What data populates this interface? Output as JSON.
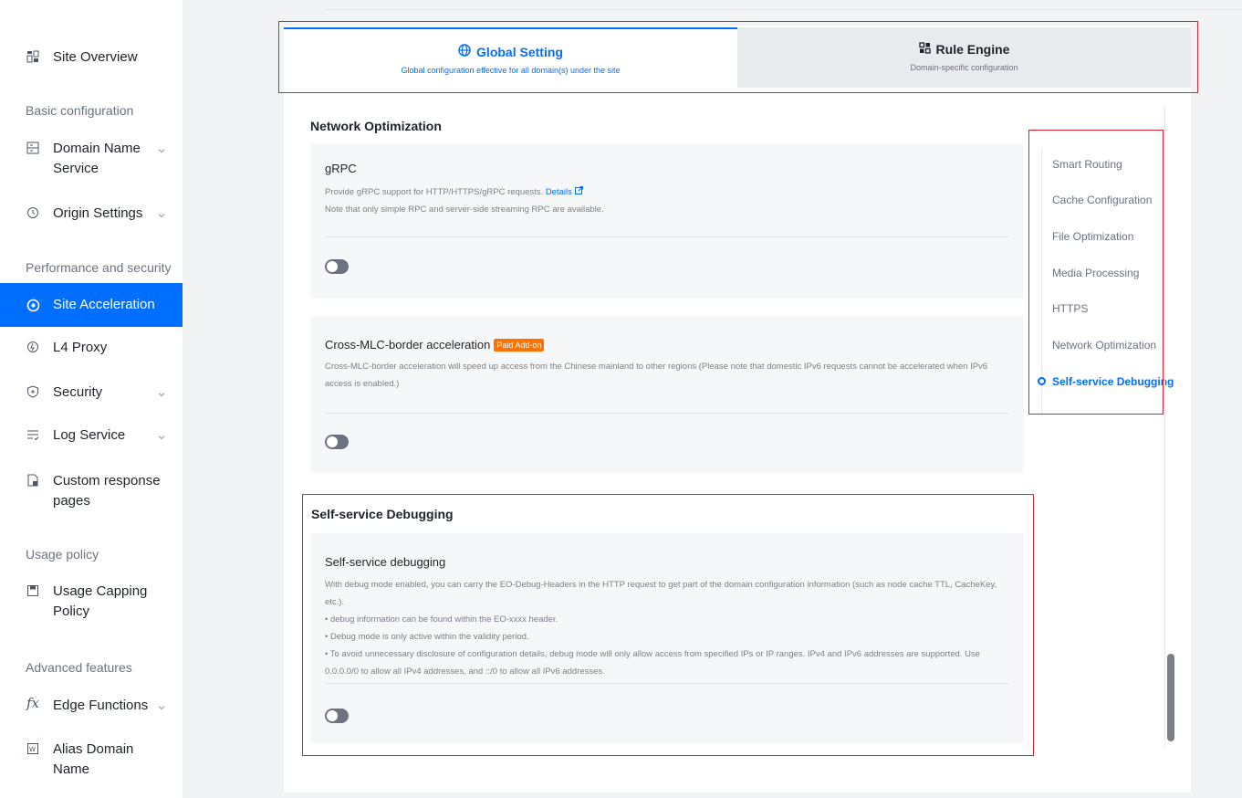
{
  "sidebar": {
    "site_overview": "Site Overview",
    "group_basic": "Basic configuration",
    "domain_name_service": "Domain Name Service",
    "origin_settings": "Origin Settings",
    "group_performance": "Performance and security",
    "site_acceleration": "Site Acceleration",
    "l4_proxy": "L4 Proxy",
    "security": "Security",
    "log_service": "Log Service",
    "custom_response_pages": "Custom response pages",
    "group_usage": "Usage policy",
    "usage_capping_policy": "Usage Capping Policy",
    "group_advanced": "Advanced features",
    "edge_functions": "Edge Functions",
    "alias_domain_name": "Alias Domain Name"
  },
  "tabs": {
    "global": {
      "title": "Global Setting",
      "subtitle": "Global configuration effective for all domain(s) under the site"
    },
    "rule": {
      "title": "Rule Engine",
      "subtitle": "Domain-specific configuration"
    }
  },
  "sections": {
    "network_optimization": "Network Optimization",
    "self_service_debugging": "Self-service Debugging"
  },
  "cards": {
    "grpc": {
      "title": "gRPC",
      "desc_line1": "Provide gRPC support for HTTP/HTTPS/gRPC requests.",
      "details_link": "Details",
      "desc_line2": "Note that only simple RPC and server-side streaming RPC are available."
    },
    "cross_mlc": {
      "title": "Cross-MLC-border acceleration",
      "badge": "Paid Add-on",
      "desc": "Cross-MLC-border acceleration will speed up access from the Chinese mainland to other regions (Please note that domestic IPv6 requests cannot be accelerated when IPv6 access is enabled.)"
    },
    "debug": {
      "title": "Self-service debugging",
      "desc_line1": "With debug mode enabled, you can carry the EO-Debug-Headers in the HTTP request to get part of the domain configuration information (such as node cache TTL, CacheKey, etc.).",
      "bullet1": "• debug information can be found within the EO-xxxx header.",
      "bullet2": "• Debug mode is only active within the validity period.",
      "bullet3": "• To avoid unnecessary disclosure of configuration details, debug mode will only allow access from specified IPs or IP ranges. IPv4 and IPv6 addresses are supported. Use 0.0.0.0/0 to allow all IPv4 addresses, and ::/0 to allow all IPv6 addresses."
    }
  },
  "anchors": [
    "Smart Routing",
    "Cache Configuration",
    "File Optimization",
    "Media Processing",
    "HTTPS",
    "Network Optimization",
    "Self-service Debugging"
  ],
  "colors": {
    "accent": "#006eff",
    "highlight": "#e0202e",
    "badge": "#ff7200"
  }
}
